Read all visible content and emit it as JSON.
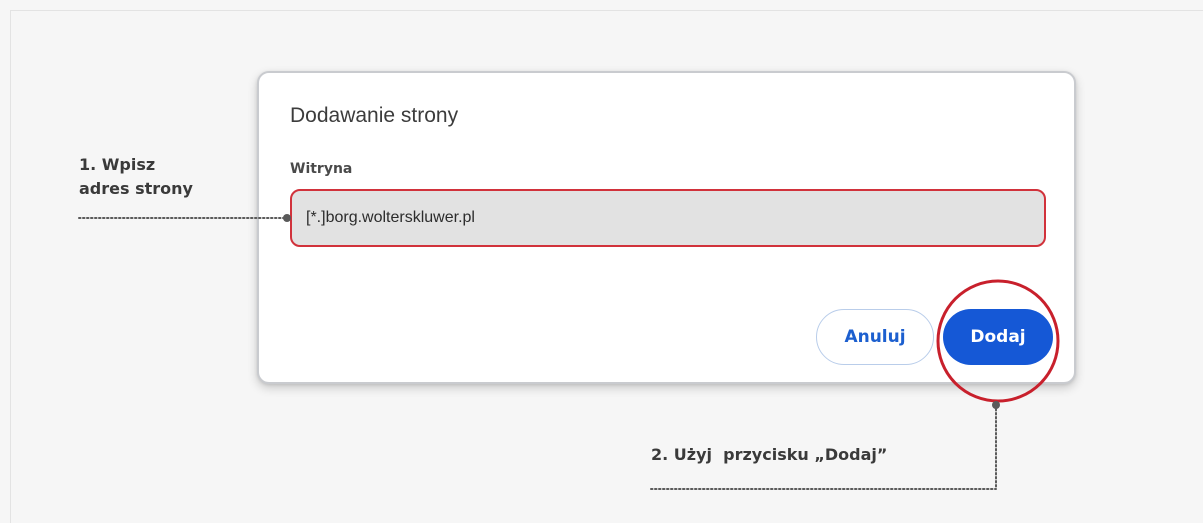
{
  "dialog": {
    "title": "Dodawanie strony",
    "field_label": "Witryna",
    "site_value": "[*.]borg.wolterskluwer.pl",
    "cancel_label": "Anuluj",
    "add_label": "Dodaj"
  },
  "annotations": {
    "step1_line1": "1. Wpisz",
    "step1_line2": "adres strony",
    "step2": "2. Użyj  przycisku „Dodaj”"
  },
  "colors": {
    "highlight": "#d1323b",
    "primary": "#1558d6",
    "dotted_line": "#5a5a5a"
  }
}
